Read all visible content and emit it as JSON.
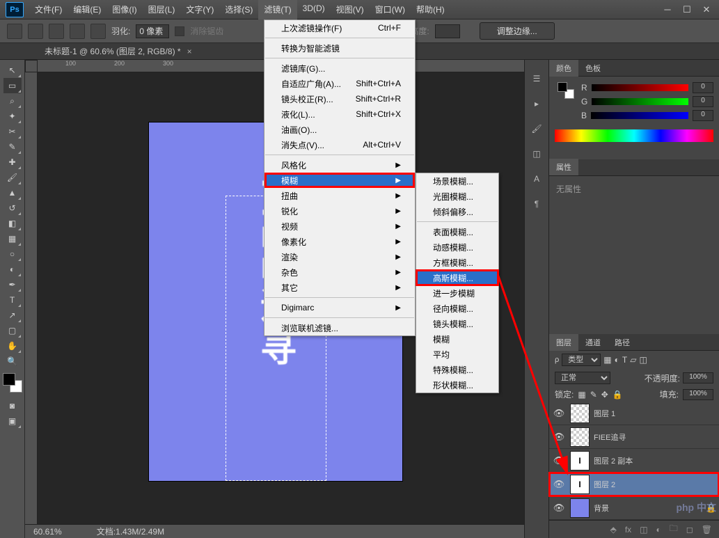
{
  "app": {
    "logo": "Ps"
  },
  "menubar": [
    "文件(F)",
    "编辑(E)",
    "图像(I)",
    "图层(L)",
    "文字(Y)",
    "选择(S)",
    "滤镜(T)",
    "3D(D)",
    "视图(V)",
    "窗口(W)",
    "帮助(H)"
  ],
  "optbar": {
    "feather_label": "羽化:",
    "feather_val": "0 像素",
    "antialias": "消除锯齿",
    "height_label": "高度:",
    "adjust_edge": "调整边缘..."
  },
  "doc_tab": {
    "title": "未标题-1 @ 60.6% (图层 2, RGB/8) *",
    "close": "×"
  },
  "canvas": {
    "text": "FIEE追寻"
  },
  "statusbar": {
    "zoom": "60.61%",
    "doc": "文档:1.43M/2.49M"
  },
  "filter_menu": [
    {
      "t": "上次滤镜操作(F)",
      "k": "Ctrl+F"
    },
    {
      "sep": true
    },
    {
      "t": "转换为智能滤镜"
    },
    {
      "sep": true
    },
    {
      "t": "滤镜库(G)..."
    },
    {
      "t": "自适应广角(A)...",
      "k": "Shift+Ctrl+A"
    },
    {
      "t": "镜头校正(R)...",
      "k": "Shift+Ctrl+R"
    },
    {
      "t": "液化(L)...",
      "k": "Shift+Ctrl+X"
    },
    {
      "t": "油画(O)..."
    },
    {
      "t": "消失点(V)...",
      "k": "Alt+Ctrl+V"
    },
    {
      "sep": true
    },
    {
      "t": "风格化",
      "sub": true
    },
    {
      "t": "模糊",
      "sub": true,
      "hl": true
    },
    {
      "t": "扭曲",
      "sub": true
    },
    {
      "t": "锐化",
      "sub": true
    },
    {
      "t": "视频",
      "sub": true
    },
    {
      "t": "像素化",
      "sub": true
    },
    {
      "t": "渲染",
      "sub": true
    },
    {
      "t": "杂色",
      "sub": true
    },
    {
      "t": "其它",
      "sub": true
    },
    {
      "sep": true
    },
    {
      "t": "Digimarc",
      "sub": true
    },
    {
      "sep": true
    },
    {
      "t": "浏览联机滤镜..."
    }
  ],
  "blur_submenu": [
    "场景模糊...",
    "光圈模糊...",
    "倾斜偏移...",
    "",
    "表面模糊...",
    "动感模糊...",
    "方框模糊...",
    "高斯模糊...",
    "进一步模糊",
    "径向模糊...",
    "镜头模糊...",
    "模糊",
    "平均",
    "特殊模糊...",
    "形状模糊..."
  ],
  "blur_hl_index": 7,
  "panels": {
    "color": {
      "tab1": "颜色",
      "tab2": "色板",
      "r": "R",
      "g": "G",
      "b": "B",
      "val": "0"
    },
    "props": {
      "tab": "属性",
      "none": "无属性"
    },
    "layers": {
      "tab1": "图层",
      "tab2": "通道",
      "tab3": "路径",
      "type": "类型",
      "mode": "正常",
      "opacity_label": "不透明度:",
      "opacity": "100%",
      "lock": "锁定:",
      "fill_label": "填充:",
      "fill": "100%",
      "items": [
        {
          "name": "图层 1",
          "thumb": "trans"
        },
        {
          "name": "FIEE追寻",
          "thumb": "trans"
        },
        {
          "name": "图层 2 副本",
          "thumb": "white"
        },
        {
          "name": "图层 2",
          "thumb": "white",
          "sel": true
        },
        {
          "name": "背景",
          "thumb": "purple",
          "lock": true
        }
      ]
    }
  },
  "php": "php 中文"
}
